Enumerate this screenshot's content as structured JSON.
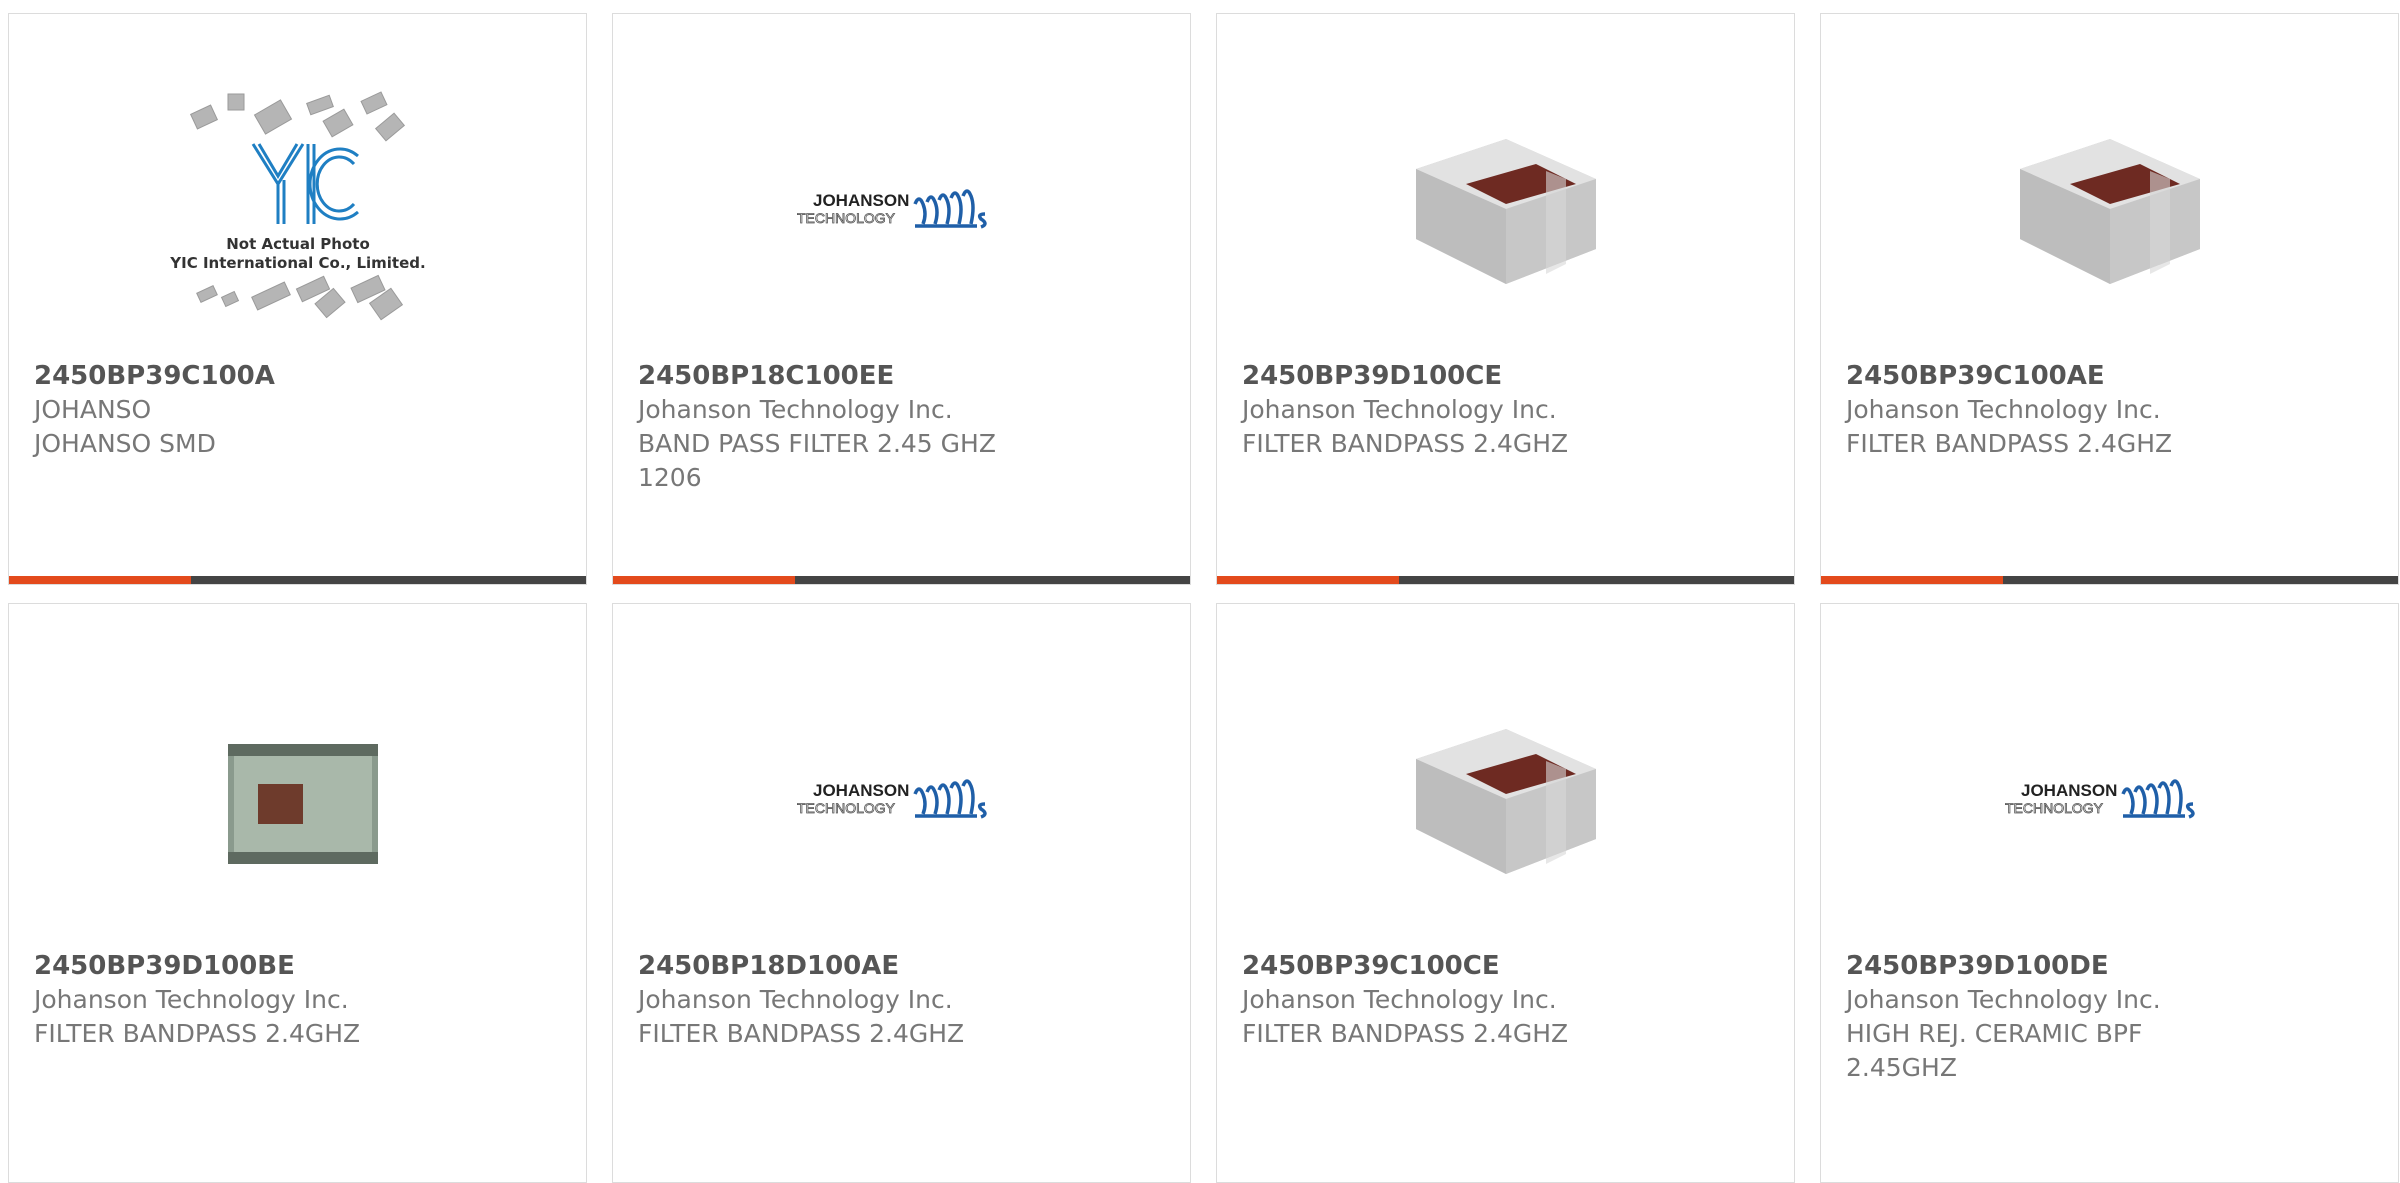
{
  "products": [
    {
      "part": "2450BP39C100A",
      "manufacturer": "JOHANSO",
      "description": "JOHANSO SMD",
      "image": "not-actual-photo-placeholder",
      "image_text": [
        "Not Actual Photo",
        "YIC International Co., Limited."
      ]
    },
    {
      "part": "2450BP18C100EE",
      "manufacturer": "Johanson Technology Inc.",
      "description": "BAND PASS FILTER 2.45 GHZ 1206",
      "image": "johanson-technology-logo"
    },
    {
      "part": "2450BP39D100CE",
      "manufacturer": "Johanson Technology Inc.",
      "description": "FILTER BANDPASS 2.4GHZ",
      "image": "ceramic-chip-component"
    },
    {
      "part": "2450BP39C100AE",
      "manufacturer": "Johanson Technology Inc.",
      "description": "FILTER BANDPASS 2.4GHZ",
      "image": "ceramic-chip-component"
    },
    {
      "part": "2450BP39D100BE",
      "manufacturer": "Johanson Technology Inc.",
      "description": "FILTER BANDPASS 2.4GHZ",
      "image": "green-chip-component"
    },
    {
      "part": "2450BP18D100AE",
      "manufacturer": "Johanson Technology Inc.",
      "description": "FILTER BANDPASS 2.4GHZ",
      "image": "johanson-technology-logo"
    },
    {
      "part": "2450BP39C100CE",
      "manufacturer": "Johanson Technology Inc.",
      "description": "FILTER BANDPASS 2.4GHZ",
      "image": "ceramic-chip-component"
    },
    {
      "part": "2450BP39D100DE",
      "manufacturer": "Johanson Technology Inc.",
      "description": "HIGH REJ. CERAMIC BPF 2.45GHZ",
      "image": "johanson-technology-logo"
    }
  ],
  "logo": {
    "line1": "JOHANSON",
    "line2": "TECHNOLOGY"
  },
  "colors": {
    "accent": "#e34a1c",
    "bar": "#444444",
    "logo_blue": "#1f5fa8"
  }
}
